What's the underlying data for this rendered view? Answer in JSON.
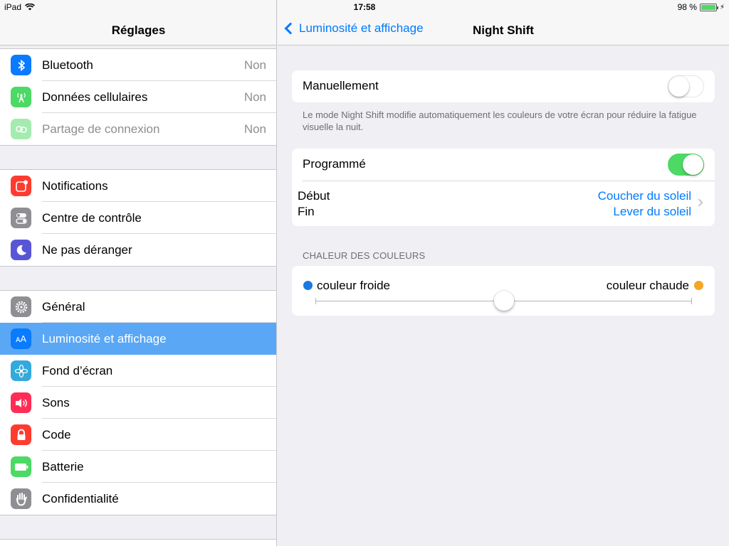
{
  "status": {
    "device": "iPad",
    "time": "17:58",
    "battery": "98 %",
    "battery_level": 0.98
  },
  "master": {
    "title": "Réglages",
    "groups": [
      [
        {
          "label": "Bluetooth",
          "value": "Non",
          "icon": "bluetooth-icon",
          "color": "#0a7aff"
        },
        {
          "label": "Données cellulaires",
          "value": "Non",
          "icon": "cellular-antenna-icon",
          "color": "#4cd964"
        },
        {
          "label": "Partage de connexion",
          "value": "Non",
          "icon": "hotspot-icon",
          "color": "#4cd964",
          "disabled": true
        }
      ],
      [
        {
          "label": "Notifications",
          "icon": "notifications-icon",
          "color": "#ff3b30"
        },
        {
          "label": "Centre de contrôle",
          "icon": "control-center-icon",
          "color": "#8e8e93"
        },
        {
          "label": "Ne pas déranger",
          "icon": "moon-icon",
          "color": "#5856d6"
        }
      ],
      [
        {
          "label": "Général",
          "icon": "gear-icon",
          "color": "#8e8e93"
        },
        {
          "label": "Luminosité et affichage",
          "icon": "brightness-aa-icon",
          "color": "#0a7aff",
          "selected": true
        },
        {
          "label": "Fond d’écran",
          "icon": "flower-icon",
          "color": "#34aadc"
        },
        {
          "label": "Sons",
          "icon": "speaker-icon",
          "color": "#ff2d55"
        },
        {
          "label": "Code",
          "icon": "lock-icon",
          "color": "#ff3b30"
        },
        {
          "label": "Batterie",
          "icon": "battery-icon",
          "color": "#4cd964"
        },
        {
          "label": "Confidentialité",
          "icon": "hand-icon",
          "color": "#8e8e93"
        }
      ]
    ]
  },
  "detail": {
    "back_label": "Luminosité et affichage",
    "title": "Night Shift",
    "manual_label": "Manuellement",
    "manual_on": false,
    "footnote": "Le mode Night Shift modifie automatiquement les couleurs de votre écran pour réduire la fatigue visuelle la nuit.",
    "scheduled_label": "Programmé",
    "scheduled_on": true,
    "start_label": "Début",
    "end_label": "Fin",
    "start_value": "Coucher du soleil",
    "end_value": "Lever du soleil",
    "warmth_header": "CHALEUR DES COULEURS",
    "cool_label": "couleur froide",
    "warm_label": "couleur chaude",
    "cool_color": "#1a7ae0",
    "warm_color": "#f5a623",
    "warmth_level": 0.5
  }
}
